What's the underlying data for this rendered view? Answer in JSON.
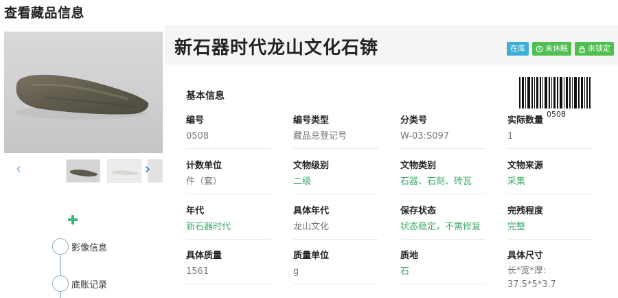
{
  "page": {
    "title": "查看藏品信息"
  },
  "gallery": {
    "prev_label": "‹",
    "next_label": "›"
  },
  "timeline": {
    "items": [
      {
        "label": "影像信息"
      },
      {
        "label": "底账记录"
      }
    ]
  },
  "relic": {
    "name": "新石器时代龙山文化石锛",
    "badges": [
      {
        "label": "在库",
        "color": "#3bb0d6"
      },
      {
        "label": "未休眠",
        "icon": "clock-icon",
        "color": "#4fbf50"
      },
      {
        "label": "未锁定",
        "icon": "lock-icon",
        "color": "#4fbf50"
      }
    ],
    "barcode_number": "0508"
  },
  "basic_info": {
    "title": "基本信息",
    "fields": [
      {
        "label": "编号",
        "value": "0508"
      },
      {
        "label": "编号类型",
        "value": "藏品总登记号"
      },
      {
        "label": "分类号",
        "value": "W-03:S097"
      },
      {
        "label": "实际数量",
        "value": "1"
      },
      {
        "label": "计数单位",
        "value": "件（套）"
      },
      {
        "label": "文物级别",
        "value": "二级"
      },
      {
        "label": "文物类别",
        "value": "石器、石刻、砖瓦"
      },
      {
        "label": "文物来源",
        "value": "采集"
      },
      {
        "label": "年代",
        "value": "新石器时代"
      },
      {
        "label": "具体年代",
        "value": "龙山文化"
      },
      {
        "label": "保存状态",
        "value": "状态稳定，不需修复"
      },
      {
        "label": "完残程度",
        "value": "完整"
      },
      {
        "label": "具体质量",
        "value": "1561"
      },
      {
        "label": "质量单位",
        "value": "g"
      },
      {
        "label": "质地",
        "value": "石"
      },
      {
        "label": "具体尺寸",
        "value_line1": "长*宽*厚:",
        "value_line2": "37.5*5*3.7"
      }
    ]
  },
  "colors": {
    "accent_green": "#3fab6b",
    "badge_blue": "#3bb0d6",
    "badge_green": "#4fbf50"
  }
}
